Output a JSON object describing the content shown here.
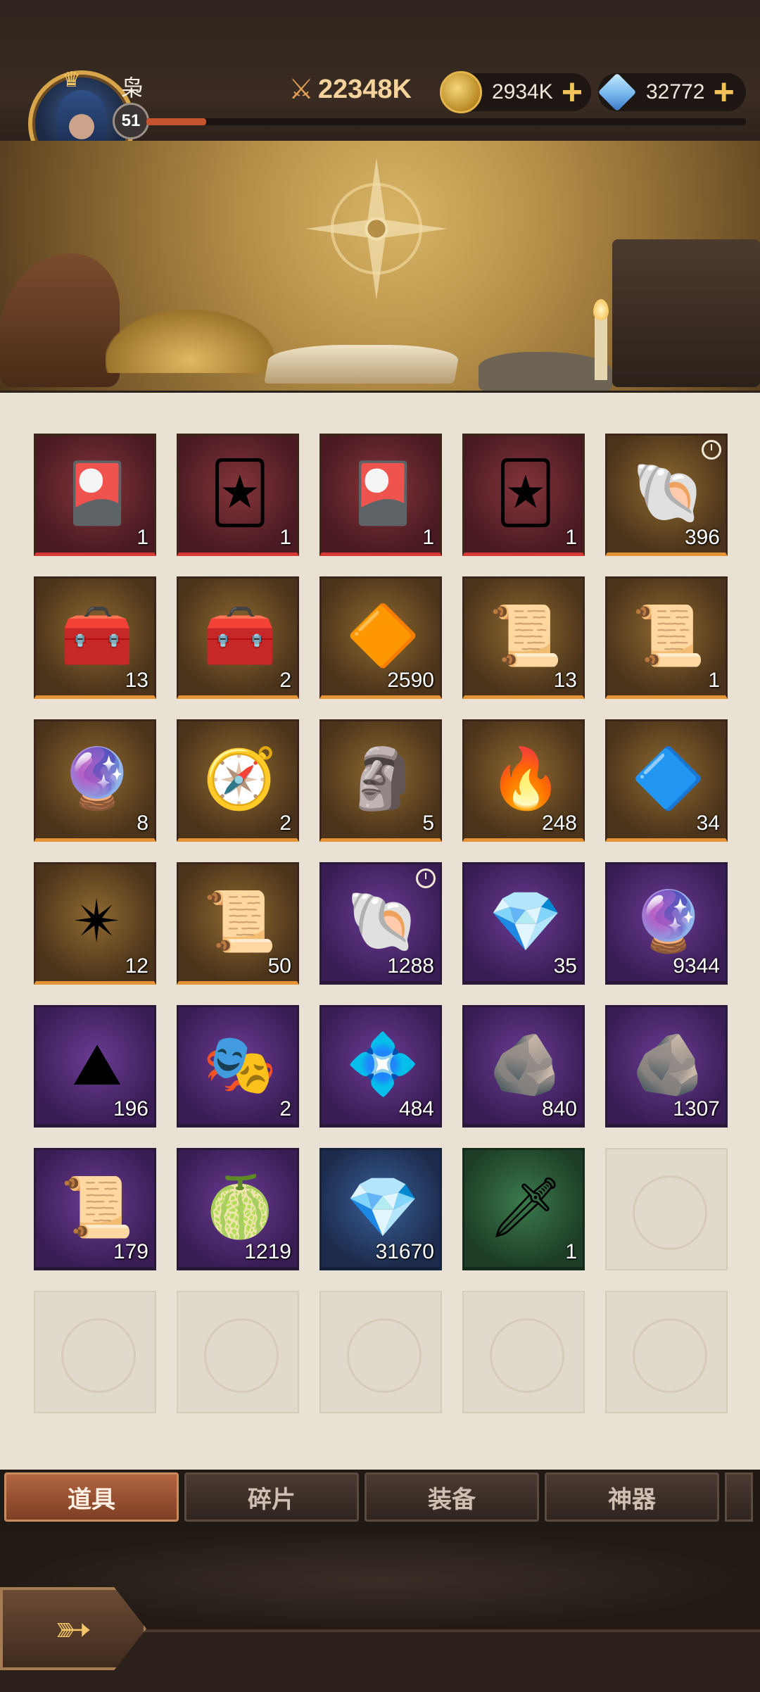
{
  "player": {
    "name": "枭",
    "level": "51",
    "xp_progress": 0.1
  },
  "power": {
    "value": "22348K",
    "icon": "crossed-swords-icon"
  },
  "currencies": {
    "gold": {
      "value": "2934K",
      "icon": "gold-coin-icon"
    },
    "gems": {
      "value": "32772",
      "icon": "diamond-icon"
    }
  },
  "items": [
    {
      "rarity": "red",
      "icon": "golden-card-pack-icon",
      "glyph": "🎴",
      "qty": "1"
    },
    {
      "rarity": "red",
      "icon": "golden-card-icon",
      "glyph": "🃏",
      "qty": "1"
    },
    {
      "rarity": "red",
      "icon": "golden-card-pack-icon",
      "glyph": "🎴",
      "qty": "1"
    },
    {
      "rarity": "red",
      "icon": "golden-card-icon",
      "glyph": "🃏",
      "qty": "1"
    },
    {
      "rarity": "gold",
      "icon": "golden-shell-icon",
      "glyph": "🐚",
      "qty": "396",
      "timed": true
    },
    {
      "rarity": "gold",
      "icon": "treasure-chest-icon",
      "glyph": "🧰",
      "qty": "13"
    },
    {
      "rarity": "gold",
      "icon": "treasure-chest-icon",
      "glyph": "🧰",
      "qty": "2"
    },
    {
      "rarity": "gold",
      "icon": "orange-crystal-icon",
      "glyph": "🔶",
      "qty": "2590"
    },
    {
      "rarity": "gold",
      "icon": "golden-scroll-icon",
      "glyph": "📜",
      "qty": "13"
    },
    {
      "rarity": "gold",
      "icon": "crystal-scroll-icon",
      "glyph": "📜",
      "qty": "1"
    },
    {
      "rarity": "gold",
      "icon": "blue-orb-icon",
      "glyph": "🔮",
      "qty": "8"
    },
    {
      "rarity": "gold",
      "icon": "compass-medallion-icon",
      "glyph": "🧭",
      "qty": "2"
    },
    {
      "rarity": "gold",
      "icon": "stone-statue-icon",
      "glyph": "🗿",
      "qty": "5"
    },
    {
      "rarity": "gold",
      "icon": "fire-ore-icon",
      "glyph": "🔥",
      "qty": "248"
    },
    {
      "rarity": "gold",
      "icon": "blue-shard-icon",
      "glyph": "🔷",
      "qty": "34"
    },
    {
      "rarity": "gold",
      "icon": "golden-star-emblem-icon",
      "glyph": "✴",
      "qty": "12"
    },
    {
      "rarity": "gold",
      "icon": "red-scroll-icon",
      "glyph": "📜",
      "qty": "50"
    },
    {
      "rarity": "purple",
      "icon": "white-shell-icon",
      "glyph": "🐚",
      "qty": "1288",
      "timed": true
    },
    {
      "rarity": "purple",
      "icon": "gem-chest-icon",
      "glyph": "💎",
      "qty": "35"
    },
    {
      "rarity": "purple",
      "icon": "purple-crystal-icon",
      "glyph": "🔮",
      "qty": "9344"
    },
    {
      "rarity": "purple",
      "icon": "teal-dust-pile-icon",
      "glyph": "⛰",
      "qty": "196"
    },
    {
      "rarity": "purple",
      "icon": "wooden-mask-icon",
      "glyph": "🎭",
      "qty": "2"
    },
    {
      "rarity": "purple",
      "icon": "blue-crystal-splash-icon",
      "glyph": "💠",
      "qty": "484"
    },
    {
      "rarity": "purple",
      "icon": "silver-ore-icon",
      "glyph": "🪨",
      "qty": "840"
    },
    {
      "rarity": "purple",
      "icon": "rune-stone-icon",
      "glyph": "🪨",
      "qty": "1307"
    },
    {
      "rarity": "purple",
      "icon": "parchment-scroll-icon",
      "glyph": "📜",
      "qty": "179"
    },
    {
      "rarity": "purple",
      "icon": "green-seed-icon",
      "glyph": "🍈",
      "qty": "1219"
    },
    {
      "rarity": "blue",
      "icon": "blue-crystal-cluster-icon",
      "glyph": "💎",
      "qty": "31670"
    },
    {
      "rarity": "green",
      "icon": "green-blade-icon",
      "glyph": "🗡",
      "qty": "1"
    }
  ],
  "empty_slots": 6,
  "tabs": [
    {
      "label": "道具",
      "active": true
    },
    {
      "label": "碎片",
      "active": false
    },
    {
      "label": "装备",
      "active": false
    },
    {
      "label": "神器",
      "active": false
    }
  ],
  "colors": {
    "rarity_red": "#d63a32",
    "rarity_gold": "#e49434",
    "rarity_purple": "#a753e0",
    "rarity_blue": "#4e8ad8",
    "rarity_green": "#49c268",
    "active_tab": "#b26540"
  }
}
